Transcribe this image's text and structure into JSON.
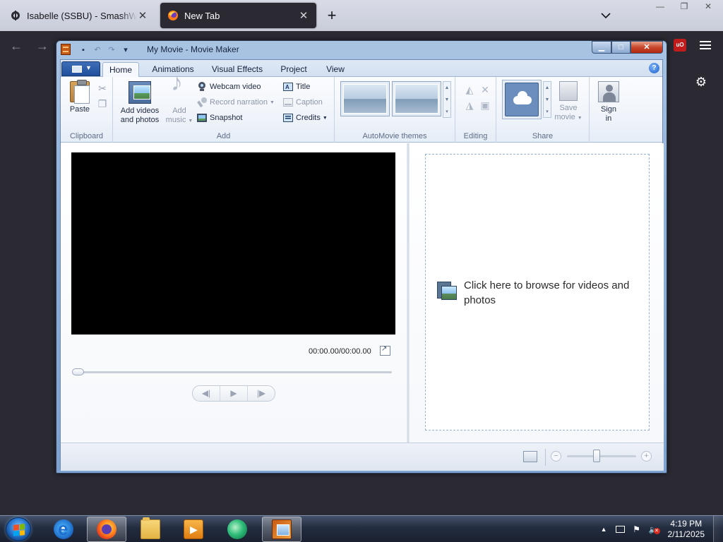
{
  "browser": {
    "tabs": [
      {
        "title": "Isabelle (SSBU) - SmashWiki, the Super Smash Bros. wiki",
        "active": false
      },
      {
        "title": "New Tab",
        "active": true
      }
    ],
    "new_tab_icon": "plus-icon",
    "list_all_tabs_icon": "chevron-down-icon",
    "extension_badge": "uO",
    "accent_color": "#2b2a33"
  },
  "moviemaker": {
    "window_title": "My Movie - Movie Maker",
    "ribbon_tabs": [
      "Home",
      "Animations",
      "Visual Effects",
      "Project",
      "View"
    ],
    "active_tab": "Home",
    "groups": {
      "clipboard": {
        "label": "Clipboard",
        "paste": "Paste"
      },
      "add": {
        "label": "Add",
        "add_videos_line1": "Add videos",
        "add_videos_line2": "and photos",
        "add_music_line1": "Add",
        "add_music_line2": "music",
        "webcam_video": "Webcam video",
        "record_narration": "Record narration",
        "snapshot": "Snapshot",
        "title": "Title",
        "caption": "Caption",
        "credits": "Credits"
      },
      "automovie": {
        "label": "AutoMovie themes"
      },
      "editing": {
        "label": "Editing"
      },
      "share": {
        "label": "Share",
        "save_movie_line1": "Save",
        "save_movie_line2": "movie",
        "sign_in_line1": "Sign",
        "sign_in_line2": "in"
      }
    },
    "preview": {
      "time": "00:00.00/00:00.00",
      "position_fraction": 0
    },
    "storyboard": {
      "prompt": "Click here to browse for videos and photos"
    },
    "status": {
      "zoom_fraction": 0.42
    }
  },
  "taskbar": {
    "apps": [
      {
        "name": "Internet Explorer",
        "icon": "ie-icon",
        "active": false
      },
      {
        "name": "Firefox",
        "icon": "firefox-icon",
        "active": true
      },
      {
        "name": "Windows Explorer",
        "icon": "folder-icon",
        "active": false
      },
      {
        "name": "Windows Media Player",
        "icon": "media-player-icon",
        "active": false
      },
      {
        "name": "Windows Live",
        "icon": "windows-live-icon",
        "active": false
      },
      {
        "name": "Movie Maker",
        "icon": "movie-maker-icon",
        "active": true
      }
    ],
    "clock": {
      "time": "4:19 PM",
      "date": "2/11/2025"
    }
  }
}
